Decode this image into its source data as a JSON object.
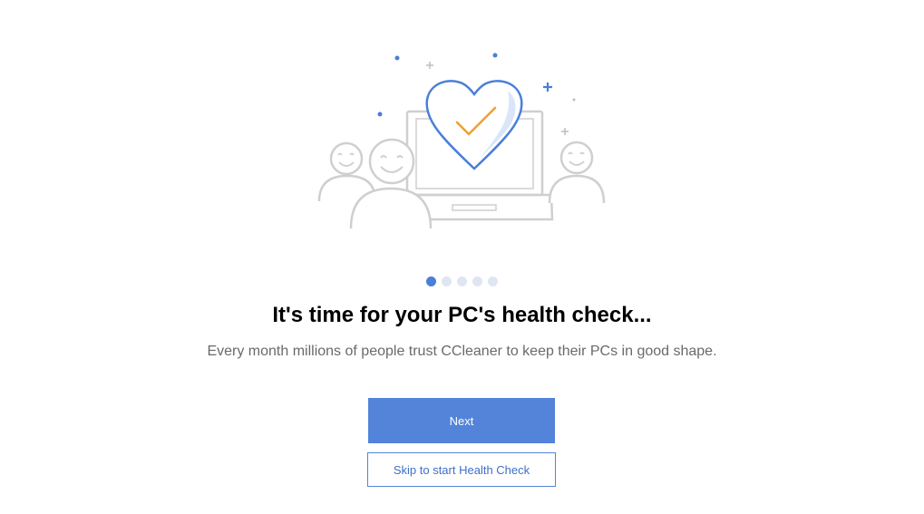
{
  "illustration": {
    "icons": [
      "laptop-icon",
      "heart-icon",
      "checkmark-icon",
      "smiling-person-icon"
    ],
    "colors": {
      "outline_gray": "#cfcfcf",
      "heart_blue": "#4a7fd8",
      "heart_fill": "#d9e6fa",
      "check_orange": "#f0a030",
      "sparkle_blue": "#4a7fd8"
    }
  },
  "pager": {
    "total_steps": 5,
    "current_step": 1
  },
  "headline": "It's time for your PC's health check...",
  "subtitle": "Every month millions of people trust CCleaner to keep their PCs in good shape.",
  "buttons": {
    "next_label": "Next",
    "skip_label": "Skip to start Health Check"
  },
  "colors": {
    "primary": "#5384da",
    "active_dot": "#4a7fd8",
    "inactive_dot": "#dfe5f3",
    "subtitle_text": "#6a6a6a"
  }
}
